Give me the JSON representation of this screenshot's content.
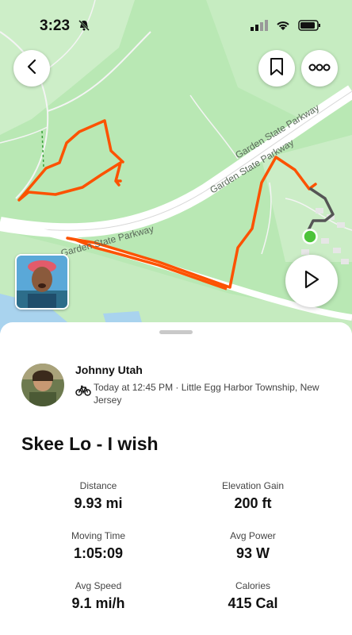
{
  "status_bar": {
    "time": "3:23"
  },
  "map": {
    "road_labels": [
      "Garden State Parkway",
      "Garden State Parkway",
      "Garden State Parkway"
    ],
    "route_color": "#fc5200",
    "end_marker_color": "#4cc33a"
  },
  "controls": {
    "back_icon": "chevron-left-icon",
    "bookmark_icon": "bookmark-icon",
    "more_icon": "more-dots-icon",
    "play_icon": "play-icon"
  },
  "activity": {
    "athlete_name": "Johnny Utah",
    "sport_icon": "bike-icon",
    "date_location": "Today at 12:45 PM · Little Egg Harbor Township, New Jersey",
    "title": "Skee Lo - I wish"
  },
  "stats": [
    {
      "label": "Distance",
      "value": "9.93 mi"
    },
    {
      "label": "Elevation Gain",
      "value": "200 ft"
    },
    {
      "label": "Moving Time",
      "value": "1:05:09"
    },
    {
      "label": "Avg Power",
      "value": "93 W"
    },
    {
      "label": "Avg Speed",
      "value": "9.1 mi/h"
    },
    {
      "label": "Calories",
      "value": "415 Cal"
    }
  ]
}
